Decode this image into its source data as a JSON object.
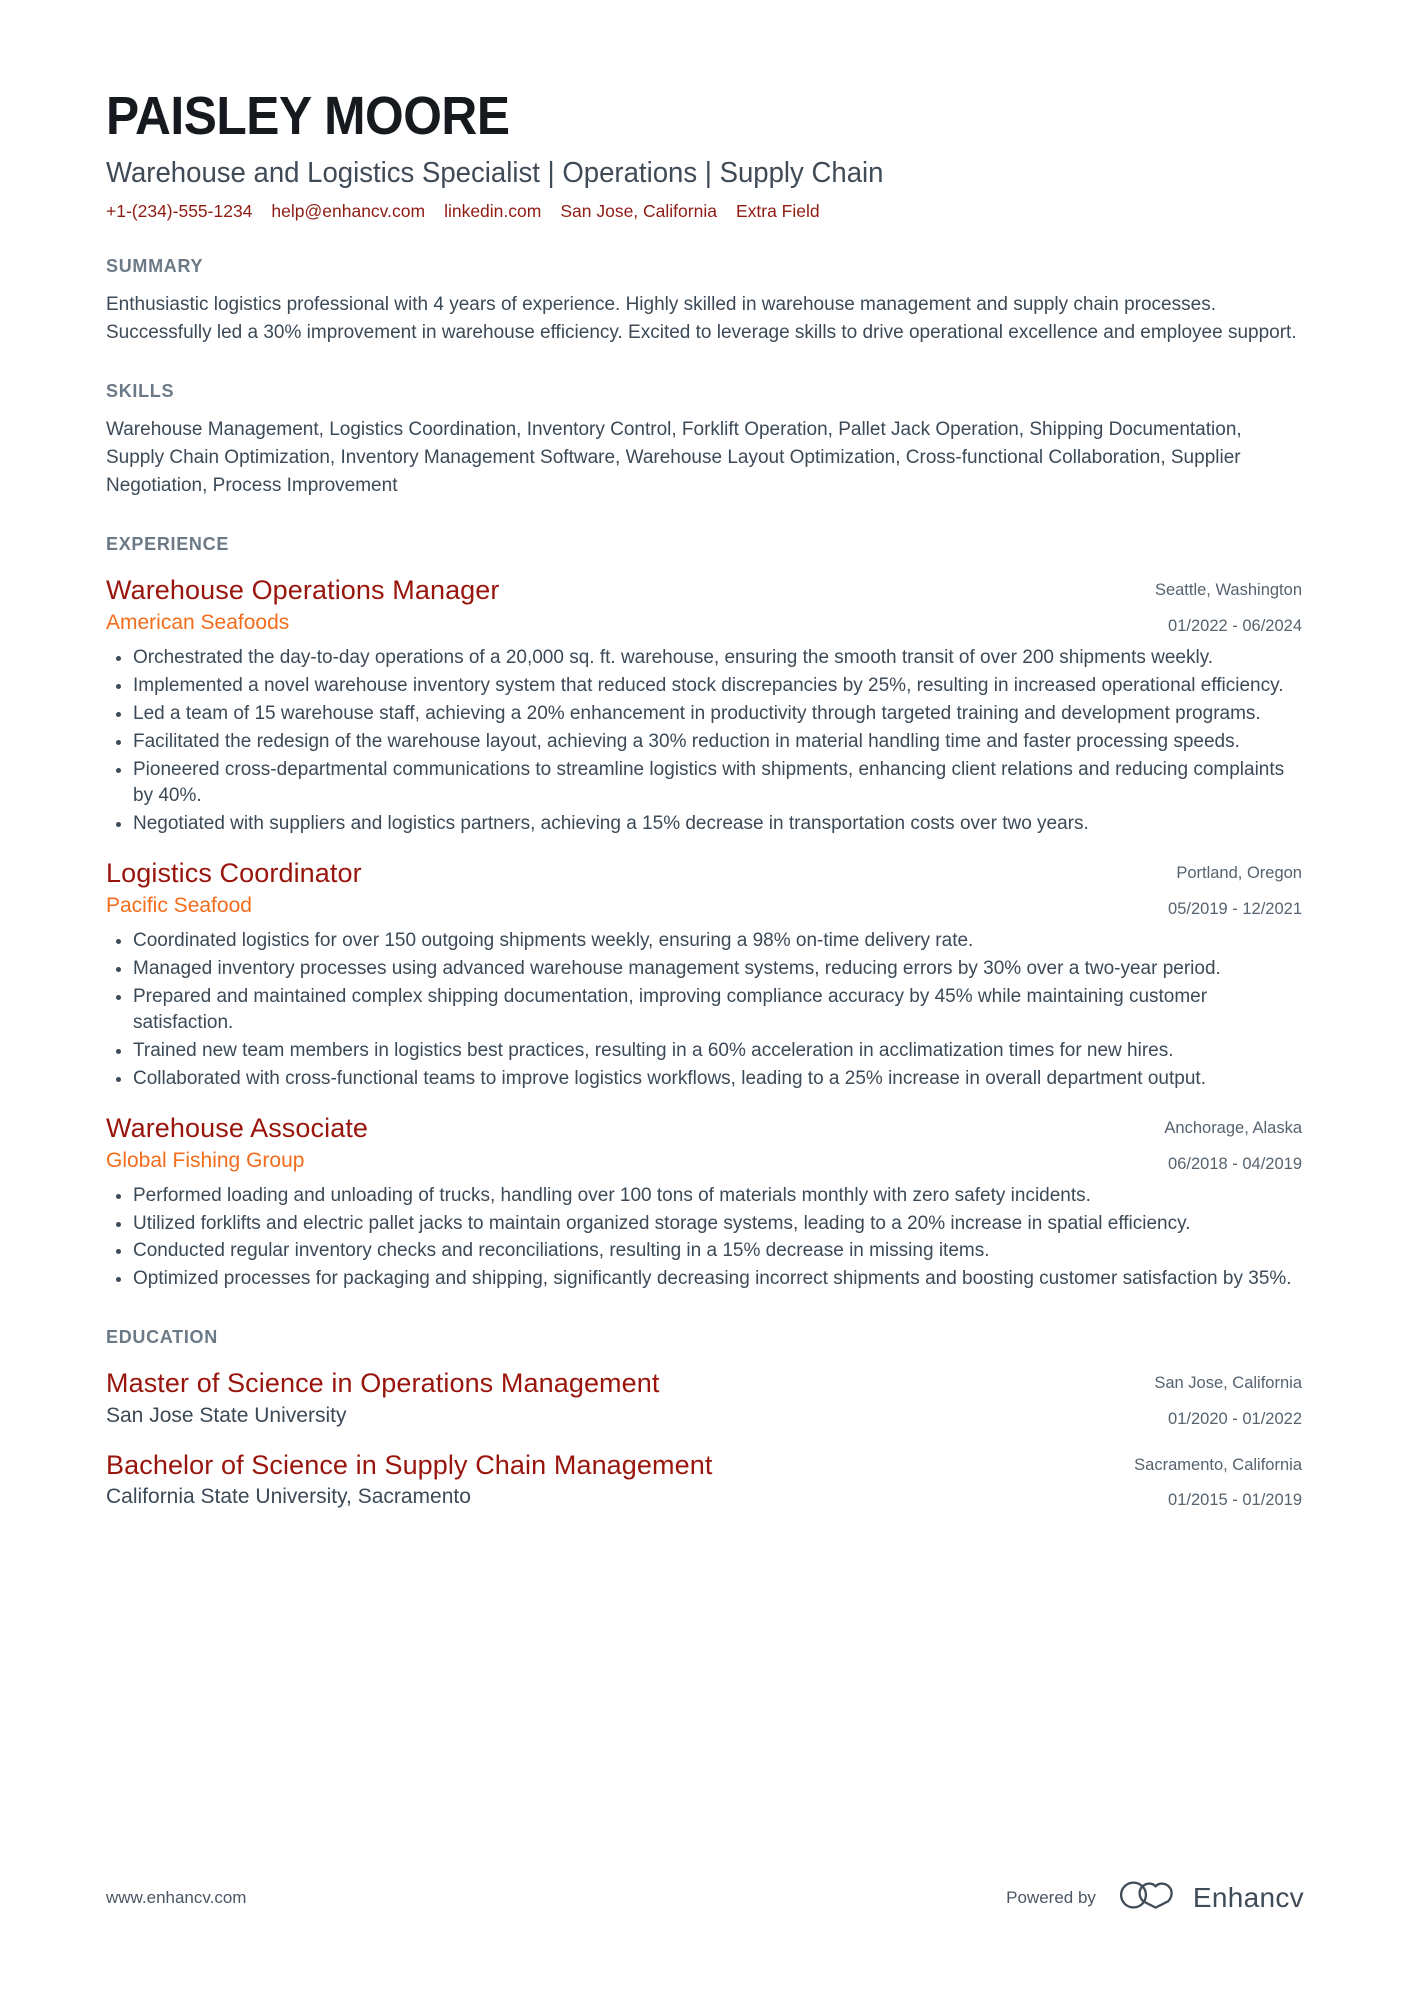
{
  "header": {
    "name": "PAISLEY MOORE",
    "headline": "Warehouse and Logistics Specialist | Operations | Supply Chain",
    "contacts": [
      {
        "name": "phone",
        "text": "+1-(234)-555-1234"
      },
      {
        "name": "email",
        "text": "help@enhancv.com"
      },
      {
        "name": "linkedin",
        "text": "linkedin.com"
      },
      {
        "name": "location",
        "text": "San Jose, California"
      },
      {
        "name": "extra",
        "text": "Extra Field"
      }
    ]
  },
  "summary": {
    "title": "SUMMARY",
    "text": "Enthusiastic logistics professional with 4 years of experience. Highly skilled in warehouse management and supply chain processes. Successfully led a 30% improvement in warehouse efficiency. Excited to leverage skills to drive operational excellence and employee support."
  },
  "skills": {
    "title": "SKILLS",
    "text": "Warehouse Management, Logistics Coordination, Inventory Control, Forklift Operation, Pallet Jack Operation, Shipping Documentation, Supply Chain Optimization, Inventory Management Software, Warehouse Layout Optimization, Cross-functional Collaboration, Supplier Negotiation, Process Improvement"
  },
  "experience": {
    "title": "EXPERIENCE",
    "entries": [
      {
        "title": "Warehouse Operations Manager",
        "company": "American Seafoods",
        "location": "Seattle, Washington",
        "dates": "01/2022 - 06/2024",
        "bullets": [
          "Orchestrated the day-to-day operations of a 20,000 sq. ft. warehouse, ensuring the smooth transit of over 200 shipments weekly.",
          "Implemented a novel warehouse inventory system that reduced stock discrepancies by 25%, resulting in increased operational efficiency.",
          "Led a team of 15 warehouse staff, achieving a 20% enhancement in productivity through targeted training and development programs.",
          "Facilitated the redesign of the warehouse layout, achieving a 30% reduction in material handling time and faster processing speeds.",
          "Pioneered cross-departmental communications to streamline logistics with shipments, enhancing client relations and reducing complaints by 40%.",
          "Negotiated with suppliers and logistics partners, achieving a 15% decrease in transportation costs over two years."
        ]
      },
      {
        "title": "Logistics Coordinator",
        "company": "Pacific Seafood",
        "location": "Portland, Oregon",
        "dates": "05/2019 - 12/2021",
        "bullets": [
          "Coordinated logistics for over 150 outgoing shipments weekly, ensuring a 98% on-time delivery rate.",
          "Managed inventory processes using advanced warehouse management systems, reducing errors by 30% over a two-year period.",
          "Prepared and maintained complex shipping documentation, improving compliance accuracy by 45% while maintaining customer satisfaction.",
          "Trained new team members in logistics best practices, resulting in a 60% acceleration in acclimatization times for new hires.",
          "Collaborated with cross-functional teams to improve logistics workflows, leading to a 25% increase in overall department output."
        ]
      },
      {
        "title": "Warehouse Associate",
        "company": "Global Fishing Group",
        "location": "Anchorage, Alaska",
        "dates": "06/2018 - 04/2019",
        "bullets": [
          "Performed loading and unloading of trucks, handling over 100 tons of materials monthly with zero safety incidents.",
          "Utilized forklifts and electric pallet jacks to maintain organized storage systems, leading to a 20% increase in spatial efficiency.",
          "Conducted regular inventory checks and reconciliations, resulting in a 15% decrease in missing items.",
          "Optimized processes for packaging and shipping, significantly decreasing incorrect shipments and boosting customer satisfaction by 35%."
        ]
      }
    ]
  },
  "education": {
    "title": "EDUCATION",
    "entries": [
      {
        "title": "Master of Science in Operations Management",
        "school": "San Jose State University",
        "location": "San Jose, California",
        "dates": "01/2020 - 01/2022"
      },
      {
        "title": "Bachelor of Science in Supply Chain Management",
        "school": "California State University, Sacramento",
        "location": "Sacramento, California",
        "dates": "01/2015 - 01/2019"
      }
    ]
  },
  "footer": {
    "url": "www.enhancv.com",
    "powered_by": "Powered by",
    "brand": "Enhancv"
  },
  "colors": {
    "accent_title": "#99150c",
    "accent_company": "#f26c1b",
    "contact": "#8f1c14",
    "section_title": "#6c7a87",
    "body": "#3c4a57"
  }
}
